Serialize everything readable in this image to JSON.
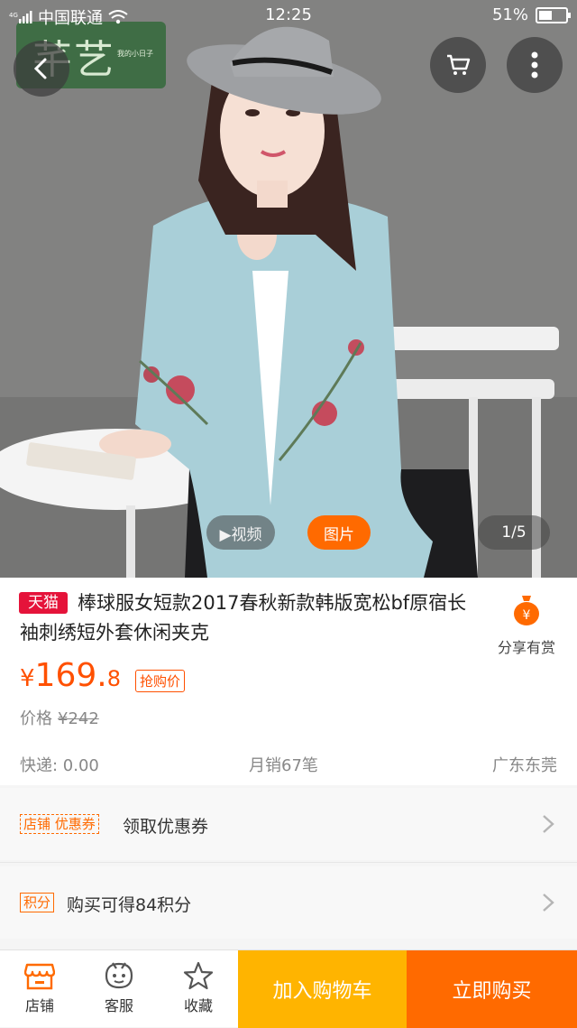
{
  "status_bar": {
    "carrier": "中国联通",
    "time": "12:25",
    "battery": "51%",
    "battery_level": 0.51
  },
  "hero": {
    "logo_text": "芊艺",
    "logo_subtitle": "我的小日子",
    "media_tabs": {
      "video": "▶视频",
      "picture": "图片"
    },
    "counter": "1/5",
    "background_color": "#7f7f7e"
  },
  "product": {
    "store_badge": "天猫",
    "title": "棒球服女短款2017春秋新款韩版宽松bf原宿长袖刺绣短外套休闲夹克",
    "share_label": "分享有赏",
    "price_symbol": "¥",
    "price_integer": "169.",
    "price_decimal": "8",
    "price_tag": "抢购价",
    "original_price_label": "价格",
    "original_price": "¥242",
    "shipping": "快递: 0.00",
    "monthly_sales": "月销67笔",
    "location": "广东东莞"
  },
  "coupon_row": {
    "tag": "店铺 优惠券",
    "label": "领取优惠券"
  },
  "points_row": {
    "tag": "积分",
    "label": "购买可得84积分"
  },
  "bottom_bar": {
    "shop": "店铺",
    "service": "客服",
    "favorite": "收藏",
    "add_to_cart": "加入购物车",
    "buy_now": "立即购买"
  },
  "colors": {
    "accent": "#ff5000",
    "tmall_red": "#e5133a",
    "cart_yellow": "#ffb400",
    "buy_orange": "#ff6a00"
  }
}
